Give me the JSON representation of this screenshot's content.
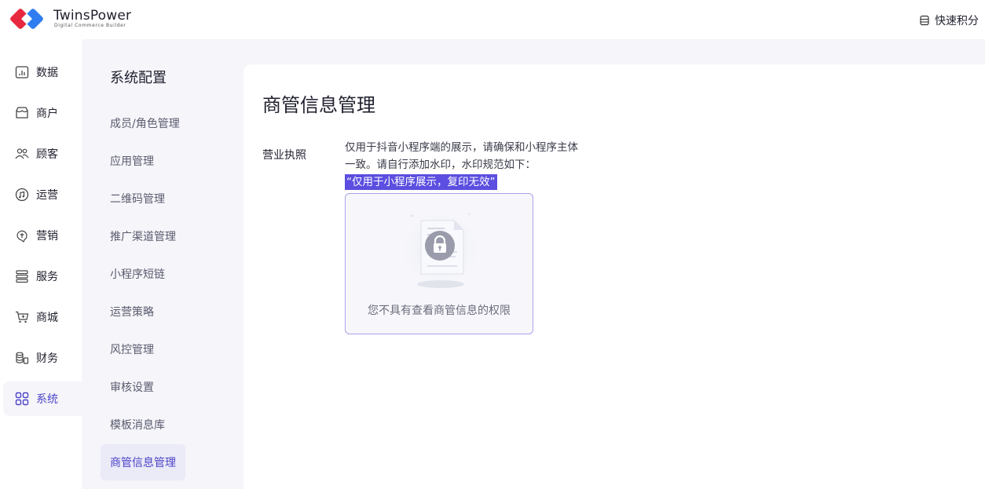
{
  "brand": {
    "name": "TwinsPower",
    "subtitle": "Digital Commerce Builder"
  },
  "header": {
    "action_label": "快速积分"
  },
  "sidebar": {
    "items": [
      {
        "label": "数据",
        "icon": "data-chart-icon"
      },
      {
        "label": "商户",
        "icon": "store-icon"
      },
      {
        "label": "顾客",
        "icon": "customers-icon"
      },
      {
        "label": "运营",
        "icon": "operations-icon"
      },
      {
        "label": "营销",
        "icon": "marketing-icon"
      },
      {
        "label": "服务",
        "icon": "service-icon"
      },
      {
        "label": "商城",
        "icon": "mall-cart-icon"
      },
      {
        "label": "财务",
        "icon": "finance-icon"
      },
      {
        "label": "系统",
        "icon": "system-grid-icon",
        "active": true
      }
    ]
  },
  "subnav": {
    "title": "系统配置",
    "items": [
      {
        "label": "成员/角色管理"
      },
      {
        "label": "应用管理"
      },
      {
        "label": "二维码管理"
      },
      {
        "label": "推广渠道管理"
      },
      {
        "label": "小程序短链"
      },
      {
        "label": "运营策略"
      },
      {
        "label": "风控管理"
      },
      {
        "label": "审核设置"
      },
      {
        "label": "模板消息库"
      },
      {
        "label": "商管信息管理",
        "active": true
      }
    ]
  },
  "main": {
    "title": "商管信息管理",
    "field_label": "营业执照",
    "desc_line1": "仅用于抖音小程序端的展示，请确保和小程序主体",
    "desc_line2": "一致。请自行添加水印，水印规范如下：",
    "watermark_example": "“仅用于小程序展示，复印无效”",
    "no_permission_text": "您不具有查看商管信息的权限"
  },
  "colors": {
    "accent": "#4b44c8",
    "highlight": "#5b4ee0",
    "panel_bg": "#f5f5fa"
  }
}
